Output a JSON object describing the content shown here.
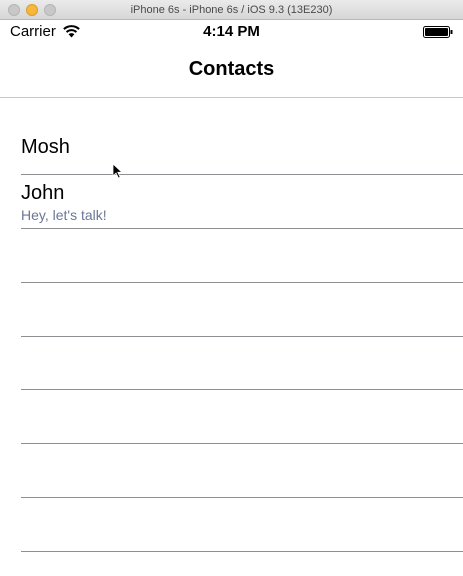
{
  "window": {
    "title": "iPhone 6s - iPhone 6s / iOS 9.3 (13E230)"
  },
  "statusbar": {
    "carrier": "Carrier",
    "time": "4:14 PM",
    "wifi_icon": "wifi-icon",
    "battery_icon": "battery-icon"
  },
  "navbar": {
    "title": "Contacts"
  },
  "contacts": [
    {
      "name": "Mosh",
      "message": ""
    },
    {
      "name": "John",
      "message": "Hey, let's talk!"
    }
  ],
  "colors": {
    "subtitle": "#6b7795",
    "separator": "#8e8e93"
  }
}
